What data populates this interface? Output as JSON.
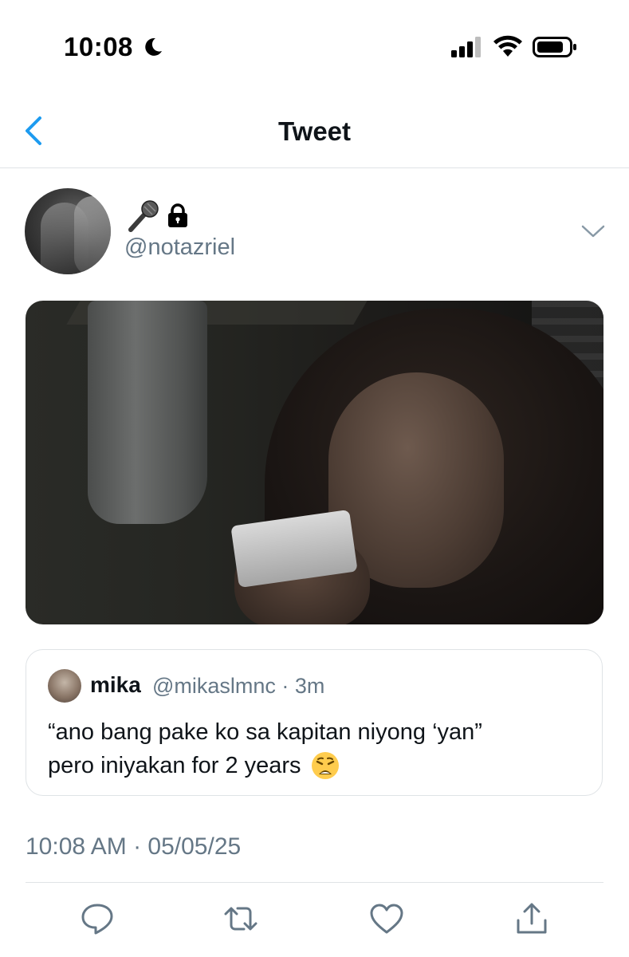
{
  "status_bar": {
    "time": "10:08",
    "icons": [
      "moon-icon",
      "cellular-signal-icon",
      "wifi-icon",
      "battery-icon"
    ]
  },
  "nav": {
    "back_icon": "chevron-left-icon",
    "title": "Tweet"
  },
  "tweet": {
    "author": {
      "display_icons": [
        "microphone-emoji",
        "lock-icon"
      ],
      "handle": "@notazriel"
    },
    "menu_icon": "chevron-down-icon",
    "media": {
      "description_icon": "photo"
    },
    "quoted": {
      "name": "mika",
      "handle_time": "@mikaslmnc · 3m",
      "text_line1": "“ano bang pake ko sa kapitan niyong ‘yan”",
      "text_line2": "pero iniyakan for 2 years",
      "emoji": "weary-face-emoji"
    },
    "timestamp": "10:08 AM · 05/05/25",
    "actions": [
      "reply-icon",
      "retweet-icon",
      "like-icon",
      "share-icon"
    ]
  },
  "colors": {
    "accent": "#1d9bf0",
    "secondary_text": "#657786",
    "divider": "#dfe3e6"
  }
}
